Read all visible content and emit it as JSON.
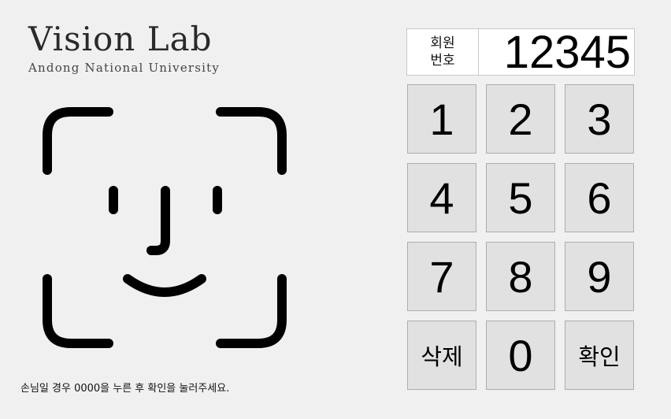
{
  "logo": {
    "title": "Vision Lab",
    "subtitle": "Andong National University"
  },
  "face_icon": {
    "icon": "face-id-icon",
    "color": "#000000"
  },
  "member": {
    "label_line1": "회원",
    "label_line2": "번호",
    "value": "12345"
  },
  "keypad": {
    "k1": "1",
    "k2": "2",
    "k3": "3",
    "k4": "4",
    "k5": "5",
    "k6": "6",
    "k7": "7",
    "k8": "8",
    "k9": "9",
    "delete": "삭제",
    "k0": "0",
    "confirm": "확인"
  },
  "notice": "손님일 경우 0000을 누른 후 확인을 눌러주세요.",
  "colors": {
    "background": "#f0f0f0",
    "key_background": "#e1e1e1",
    "key_border": "#adadad"
  }
}
